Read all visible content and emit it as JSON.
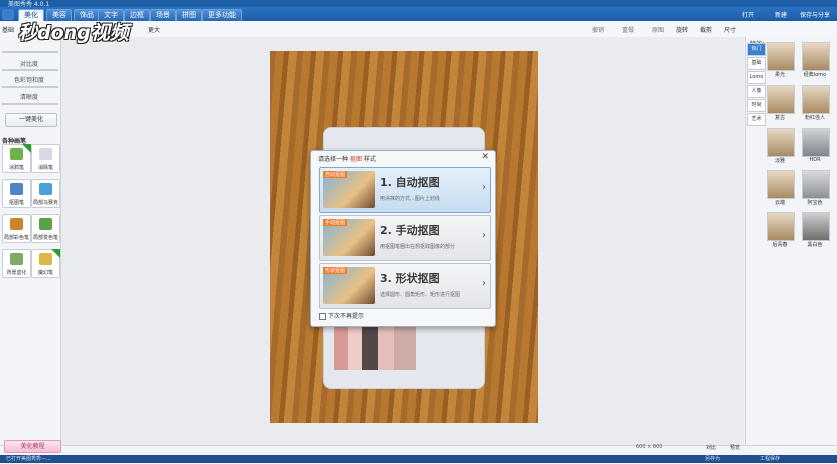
{
  "window": {
    "title": "美图秀秀 4.0.1"
  },
  "menu": {
    "tabs": [
      "美化",
      "美容",
      "饰品",
      "文字",
      "边框",
      "场景",
      "拼图",
      "更多功能"
    ],
    "active": "美化",
    "right_open": "打开",
    "right_new": "新建",
    "right_save": "保存与分享"
  },
  "toolbar": {
    "left_tab": "基础",
    "more_label": "更大",
    "undo": "撤销",
    "redo": "重做",
    "restore": "原图",
    "rotate": "旋转",
    "crop": "裁剪",
    "size": "尺寸"
  },
  "watermark": "秒dong视频",
  "left": {
    "slider_contrast": "对比度",
    "slider_saturation": "色彩饱和度",
    "slider_sharpen": "清晰度",
    "auto_btn": "一键美化",
    "section": "各种画笔",
    "tools": [
      {
        "label": "涂鸦笔",
        "icon": "brush-icon"
      },
      {
        "label": "消除笔",
        "icon": "eraser-icon"
      },
      {
        "label": "抠图笔",
        "icon": "cutout-pen-icon"
      },
      {
        "label": "局部马赛克",
        "icon": "mosaic-icon"
      },
      {
        "label": "局部彩色笔",
        "icon": "color-pen-icon"
      },
      {
        "label": "局部变色笔",
        "icon": "recolor-pen-icon"
      },
      {
        "label": "背景虚化",
        "icon": "blur-bg-icon"
      },
      {
        "label": "魔幻笔",
        "icon": "magic-pen-icon"
      }
    ],
    "bottom_btn": "美化教程"
  },
  "dialog": {
    "title_pre": "请选择一种",
    "title_hl": "抠图",
    "title_post": "样式",
    "options": [
      {
        "tag": "自动抠图",
        "title": "1. 自动抠图",
        "desc": "用涂抹的方式...图片上划线"
      },
      {
        "tag": "手动抠图",
        "title": "2. 手动抠图",
        "desc": "用抠图笔圈出在想抠取图像的部分"
      },
      {
        "tag": "形状抠图",
        "title": "3. 形状抠图",
        "desc": "选择圆形、圆角矩形、矩形进行抠图"
      }
    ],
    "dont_show": "下次不再提示"
  },
  "right": {
    "header": "特效：",
    "tabs": [
      "热门",
      "基础",
      "Lomo",
      "人像",
      "时尚",
      "艺术"
    ],
    "active_tab": "热门",
    "effects": [
      "柔光",
      "经典lomo",
      "复古",
      "粉红佳人",
      "淡雅",
      "HDR",
      "云端",
      "阿宝色",
      "后青春",
      "黑白色"
    ]
  },
  "status": {
    "size": "600 × 800",
    "compare": "对比",
    "preview": "预览"
  },
  "taskbar": {
    "left": "已打开美图秀秀—...",
    "right1": "另存为",
    "right2": "工程保存"
  }
}
